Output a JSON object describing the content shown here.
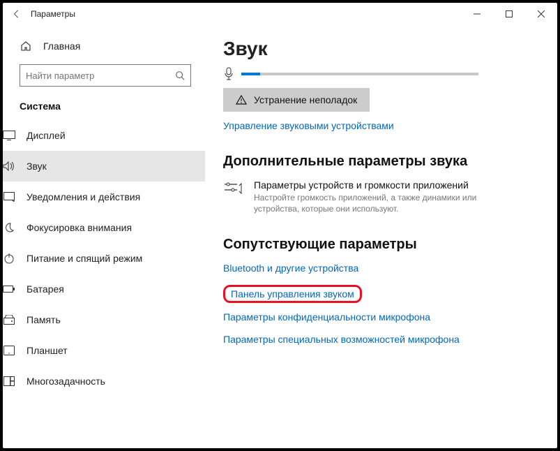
{
  "window": {
    "title": "Параметры"
  },
  "sidebar": {
    "home": "Главная",
    "search_placeholder": "Найти параметр",
    "section": "Система",
    "items": [
      {
        "label": "Дисплей"
      },
      {
        "label": "Звук"
      },
      {
        "label": "Уведомления и действия"
      },
      {
        "label": "Фокусировка внимания"
      },
      {
        "label": "Питание и спящий режим"
      },
      {
        "label": "Батарея"
      },
      {
        "label": "Память"
      },
      {
        "label": "Планшет"
      },
      {
        "label": "Многозадачность"
      }
    ]
  },
  "content": {
    "heading": "Звук",
    "troubleshoot": "Устранение неполадок",
    "manage_link": "Управление звуковыми устройствами",
    "advanced_heading": "Дополнительные параметры звука",
    "app_volume_title": "Параметры устройств и громкости приложений",
    "app_volume_desc": "Настройте громкость приложений, а также динамики или устройства, которые они используют.",
    "related_heading": "Сопутствующие параметры",
    "link_bluetooth": "Bluetooth и другие устройства",
    "link_sound_panel": "Панель управления звуком",
    "link_mic_privacy": "Параметры конфиденциальности микрофона",
    "link_mic_access": "Параметры специальных возможностей микрофона"
  }
}
